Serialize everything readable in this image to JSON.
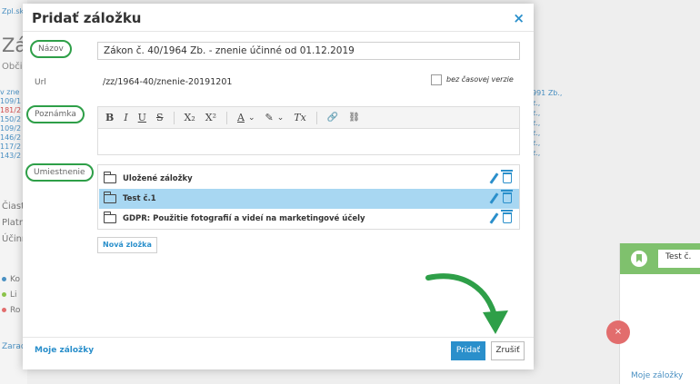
{
  "background": {
    "top_link": "Zpl.sk",
    "heading": "Zál",
    "subtitle": "Obči",
    "list_left": [
      "v zne",
      "109/1",
      "181/2",
      "150/2",
      "109/2",
      "146/2",
      "117/2",
      "143/2"
    ],
    "list_right": [
      "991 Zb.,",
      "z.,",
      "z.,",
      "z.,",
      "z.,",
      "z.,",
      "z.,"
    ],
    "rows": [
      "Čiast",
      "Platn",
      "Účinn"
    ],
    "bullets": [
      {
        "label": "Ko",
        "color": "#4a90c2"
      },
      {
        "label": "Li",
        "color": "#8bc34a"
      },
      {
        "label": "Ro",
        "color": "#e26d6d"
      }
    ],
    "zarad": "Zarad",
    "side_panel": {
      "label": "Test č.",
      "link": "Moje záložky"
    },
    "red_circle_icon": "×"
  },
  "modal": {
    "title": "Pridať záložku",
    "close_icon": "×",
    "labels": {
      "name": "Názov",
      "url": "Url",
      "note": "Poznámka",
      "location": "Umiestnenie"
    },
    "name_value": "Zákon č. 40/1964 Zb. - znenie účinné od 01.12.2019",
    "url_value": "/zz/1964-40/znenie-20191201",
    "checkbox_label": "bez časovej verzie",
    "toolbar": {
      "bold": "B",
      "italic": "I",
      "underline": "U",
      "strike": "S",
      "subscript": "X₂",
      "superscript": "X²",
      "text_color": "A",
      "dropdown": "⌄",
      "highlight": "✎",
      "clear_format": "Tx",
      "link": "🔗",
      "unlink": "⛓"
    },
    "folders": [
      {
        "name": "Uložené záložky",
        "selected": false
      },
      {
        "name": "Test č.1",
        "selected": true
      },
      {
        "name": "GDPR: Použitie fotografií a videí na marketingové účely",
        "selected": false
      }
    ],
    "new_folder_label": "Nová zložka",
    "my_bookmarks_label": "Moje záložky",
    "add_label": "Pridať",
    "cancel_label": "Zrušiť"
  },
  "colors": {
    "accent": "#2a8fcb",
    "highlight_green": "#2e9f48",
    "selected_row": "#a8d7f2",
    "side_header": "#7fc16d"
  }
}
